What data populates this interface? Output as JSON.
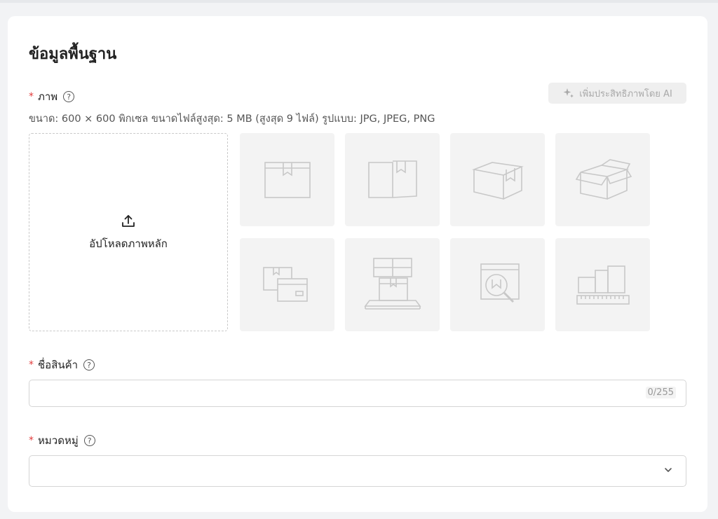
{
  "section": {
    "title": "ข้อมูลพื้นฐาน"
  },
  "image_field": {
    "required_mark": "*",
    "label": "ภาพ",
    "help": "?",
    "hint": "ขนาด: 600 × 600 พิกเซล ขนาดไฟล์สูงสุด: 5 MB (สูงสุด 9 ไฟล์) รูปแบบ: JPG, JPEG, PNG",
    "upload_label": "อัปโหลดภาพหลัก",
    "thumbnails": [
      "box-front-icon",
      "box-open-front-icon",
      "box-angle-icon",
      "box-open-top-icon",
      "box-label-icon",
      "box-on-stand-icon",
      "box-inspect-icon",
      "box-measure-icon"
    ]
  },
  "ai_button": {
    "label": "เพิ่มประสิทธิภาพโดย AI"
  },
  "name_field": {
    "required_mark": "*",
    "label": "ชื่อสินค้า",
    "help": "?",
    "value": "",
    "counter": "0/255"
  },
  "category_field": {
    "required_mark": "*",
    "label": "หมวดหมู่",
    "help": "?",
    "value": ""
  },
  "colors": {
    "required": "#e23c3c",
    "placeholder_bg": "#f3f3f3"
  }
}
